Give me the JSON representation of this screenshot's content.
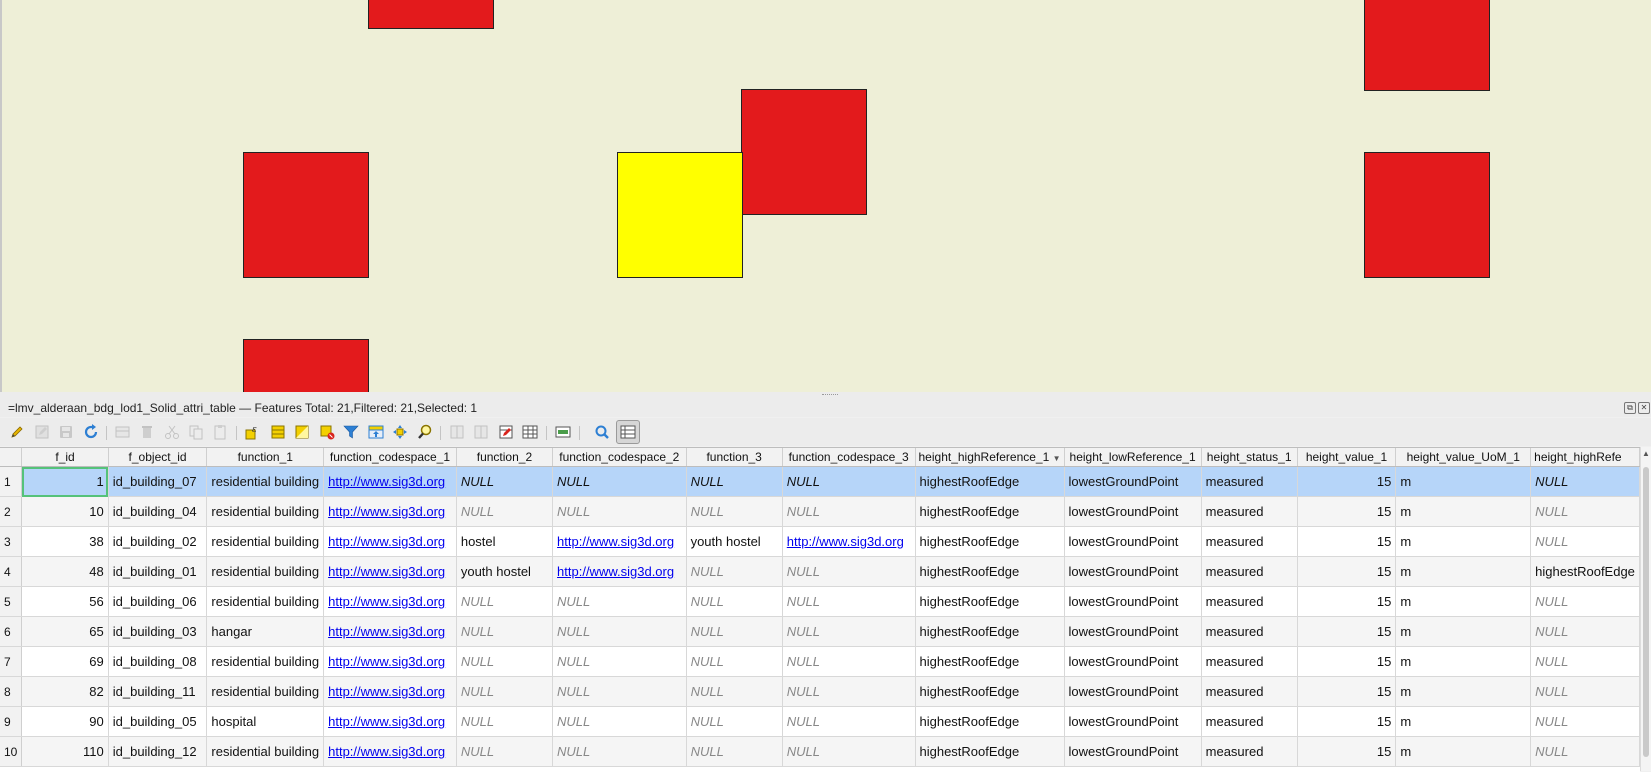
{
  "map": {
    "colors": {
      "background": "#eeefd7",
      "feature": "#e31a1c",
      "selected": "#ffff00"
    }
  },
  "attribute_table": {
    "title": "=lmv_alderaan_bdg_lod1_Solid_attri_table — Features Total: 21,Filtered: 21,Selected: 1",
    "columns": [
      "f_id",
      "f_object_id",
      "function_1",
      "function_codespace_1",
      "function_2",
      "function_codespace_2",
      "function_3",
      "function_codespace_3",
      "height_highReference_1",
      "height_lowReference_1",
      "height_status_1",
      "height_value_1",
      "height_value_UoM_1",
      "height_highRefe"
    ],
    "rows": [
      {
        "n": "1",
        "f_id": "1",
        "f_object_id": "id_building_07",
        "function_1": "residential building",
        "function_codespace_1": "http://www.sig3d.org",
        "function_2": "NULL",
        "function_codespace_2": "NULL",
        "function_3": "NULL",
        "function_codespace_3": "NULL",
        "height_highReference_1": "highestRoofEdge",
        "height_lowReference_1": "lowestGroundPoint",
        "height_status_1": "measured",
        "height_value_1": "15",
        "height_value_UoM_1": "m",
        "height_highRefe": "NULL"
      },
      {
        "n": "2",
        "f_id": "10",
        "f_object_id": "id_building_04",
        "function_1": "residential building",
        "function_codespace_1": "http://www.sig3d.org",
        "function_2": "NULL",
        "function_codespace_2": "NULL",
        "function_3": "NULL",
        "function_codespace_3": "NULL",
        "height_highReference_1": "highestRoofEdge",
        "height_lowReference_1": "lowestGroundPoint",
        "height_status_1": "measured",
        "height_value_1": "15",
        "height_value_UoM_1": "m",
        "height_highRefe": "NULL"
      },
      {
        "n": "3",
        "f_id": "38",
        "f_object_id": "id_building_02",
        "function_1": "residential building",
        "function_codespace_1": "http://www.sig3d.org",
        "function_2": "hostel",
        "function_codespace_2": "http://www.sig3d.org",
        "function_3": "youth hostel",
        "function_codespace_3": "http://www.sig3d.org",
        "height_highReference_1": "highestRoofEdge",
        "height_lowReference_1": "lowestGroundPoint",
        "height_status_1": "measured",
        "height_value_1": "15",
        "height_value_UoM_1": "m",
        "height_highRefe": "NULL"
      },
      {
        "n": "4",
        "f_id": "48",
        "f_object_id": "id_building_01",
        "function_1": "residential building",
        "function_codespace_1": "http://www.sig3d.org",
        "function_2": "youth hostel",
        "function_codespace_2": "http://www.sig3d.org",
        "function_3": "NULL",
        "function_codespace_3": "NULL",
        "height_highReference_1": "highestRoofEdge",
        "height_lowReference_1": "lowestGroundPoint",
        "height_status_1": "measured",
        "height_value_1": "15",
        "height_value_UoM_1": "m",
        "height_highRefe": "highestRoofEdge"
      },
      {
        "n": "5",
        "f_id": "56",
        "f_object_id": "id_building_06",
        "function_1": "residential building",
        "function_codespace_1": "http://www.sig3d.org",
        "function_2": "NULL",
        "function_codespace_2": "NULL",
        "function_3": "NULL",
        "function_codespace_3": "NULL",
        "height_highReference_1": "highestRoofEdge",
        "height_lowReference_1": "lowestGroundPoint",
        "height_status_1": "measured",
        "height_value_1": "15",
        "height_value_UoM_1": "m",
        "height_highRefe": "NULL"
      },
      {
        "n": "6",
        "f_id": "65",
        "f_object_id": "id_building_03",
        "function_1": "hangar",
        "function_codespace_1": "http://www.sig3d.org",
        "function_2": "NULL",
        "function_codespace_2": "NULL",
        "function_3": "NULL",
        "function_codespace_3": "NULL",
        "height_highReference_1": "highestRoofEdge",
        "height_lowReference_1": "lowestGroundPoint",
        "height_status_1": "measured",
        "height_value_1": "15",
        "height_value_UoM_1": "m",
        "height_highRefe": "NULL"
      },
      {
        "n": "7",
        "f_id": "69",
        "f_object_id": "id_building_08",
        "function_1": "residential building",
        "function_codespace_1": "http://www.sig3d.org",
        "function_2": "NULL",
        "function_codespace_2": "NULL",
        "function_3": "NULL",
        "function_codespace_3": "NULL",
        "height_highReference_1": "highestRoofEdge",
        "height_lowReference_1": "lowestGroundPoint",
        "height_status_1": "measured",
        "height_value_1": "15",
        "height_value_UoM_1": "m",
        "height_highRefe": "NULL"
      },
      {
        "n": "8",
        "f_id": "82",
        "f_object_id": "id_building_11",
        "function_1": "residential building",
        "function_codespace_1": "http://www.sig3d.org",
        "function_2": "NULL",
        "function_codespace_2": "NULL",
        "function_3": "NULL",
        "function_codespace_3": "NULL",
        "height_highReference_1": "highestRoofEdge",
        "height_lowReference_1": "lowestGroundPoint",
        "height_status_1": "measured",
        "height_value_1": "15",
        "height_value_UoM_1": "m",
        "height_highRefe": "NULL"
      },
      {
        "n": "9",
        "f_id": "90",
        "f_object_id": "id_building_05",
        "function_1": "hospital",
        "function_codespace_1": "http://www.sig3d.org",
        "function_2": "NULL",
        "function_codespace_2": "NULL",
        "function_3": "NULL",
        "function_codespace_3": "NULL",
        "height_highReference_1": "highestRoofEdge",
        "height_lowReference_1": "lowestGroundPoint",
        "height_status_1": "measured",
        "height_value_1": "15",
        "height_value_UoM_1": "m",
        "height_highRefe": "NULL"
      },
      {
        "n": "10",
        "f_id": "110",
        "f_object_id": "id_building_12",
        "function_1": "residential building",
        "function_codespace_1": "http://www.sig3d.org",
        "function_2": "NULL",
        "function_codespace_2": "NULL",
        "function_3": "NULL",
        "function_codespace_3": "NULL",
        "height_highReference_1": "highestRoofEdge",
        "height_lowReference_1": "lowestGroundPoint",
        "height_status_1": "measured",
        "height_value_1": "15",
        "height_value_UoM_1": "m",
        "height_highRefe": "NULL"
      }
    ],
    "selected_row_index": 0
  }
}
